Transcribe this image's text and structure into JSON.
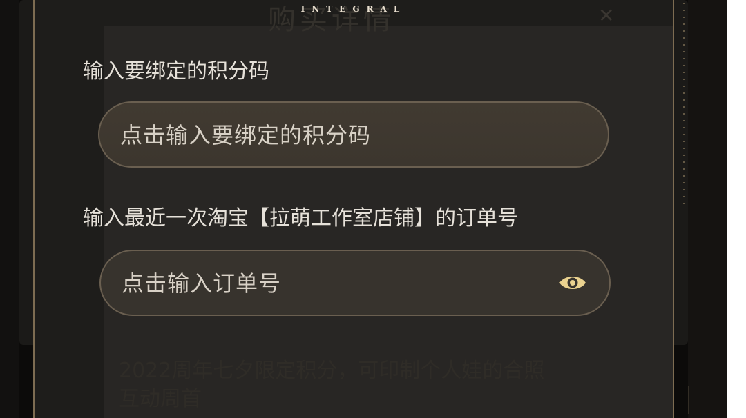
{
  "header": {
    "brand": "INTEGRAL",
    "background_title": "购买详情",
    "close_icon": "close-icon"
  },
  "form": {
    "code_label": "输入要绑定的积分码",
    "code_placeholder": "点击输入要绑定的积分码",
    "order_label": "输入最近一次淘宝【拉萌工作室店铺】的订单号",
    "order_placeholder": "点击输入订单号",
    "visibility_icon": "eye-icon"
  },
  "background_text": {
    "line1": "2022周年七夕限定积分，可印制个人娃的合照",
    "line2": "互动周首"
  },
  "colors": {
    "accent_gold": "#e8d08e",
    "panel": "#282624",
    "field_border": "#6a5f50"
  }
}
